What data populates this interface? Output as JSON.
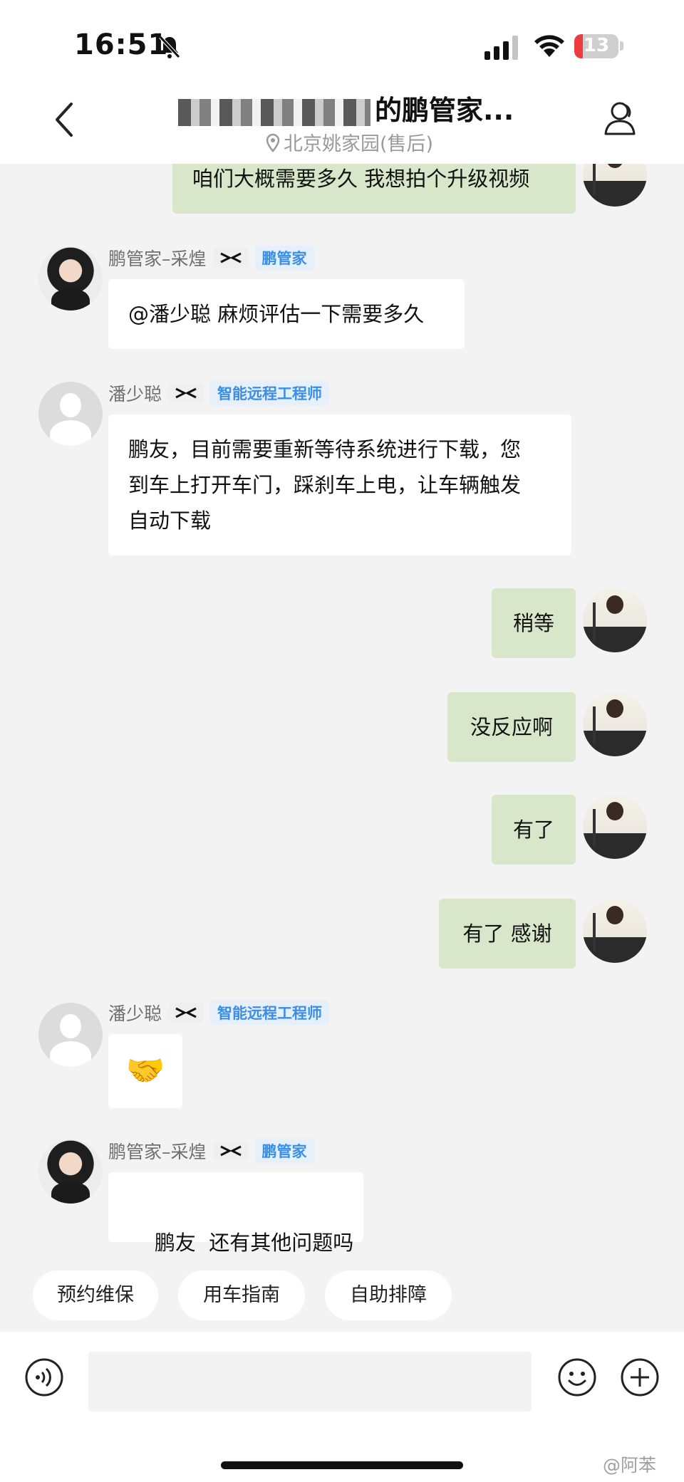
{
  "status_bar": {
    "time": "16:51",
    "battery": "13"
  },
  "header": {
    "title_suffix": "的鹏管家...",
    "location": "北京姚家园(售后)"
  },
  "messages": [
    {
      "sender": "",
      "text": "咱们大概需要多久 我想拍个升级视频"
    },
    {
      "sender": "鹏管家–采煌",
      "tag": "鹏管家",
      "text": "@潘少聪 麻烦评估一下需要多久"
    },
    {
      "sender": "潘少聪",
      "tag": "智能远程工程师",
      "lines": [
        "鹏友，目前需要重新等待系统进行下载，您",
        "到车上打开车门，踩刹车上电，让车辆触发",
        "自动下载"
      ]
    },
    {
      "text": "稍等"
    },
    {
      "text": "没反应啊"
    },
    {
      "text": "有了"
    },
    {
      "text": "有了 感谢"
    },
    {
      "sender": "潘少聪",
      "tag": "智能远程工程师",
      "emoji": "🤝"
    },
    {
      "sender": "鹏管家–采煌",
      "tag": "鹏管家",
      "text": "鹏友  还有其他问题吗"
    }
  ],
  "quick_replies": [
    "预约维保",
    "用车指南",
    "自助排障"
  ],
  "input": {
    "placeholder": ""
  },
  "watermark": "@阿苯",
  "colors": {
    "outgoing_bubble": "#d8e7c9",
    "tag_text": "#3a8ee6",
    "tag_bg": "#e5f0fb",
    "background": "#f3f3f3"
  }
}
